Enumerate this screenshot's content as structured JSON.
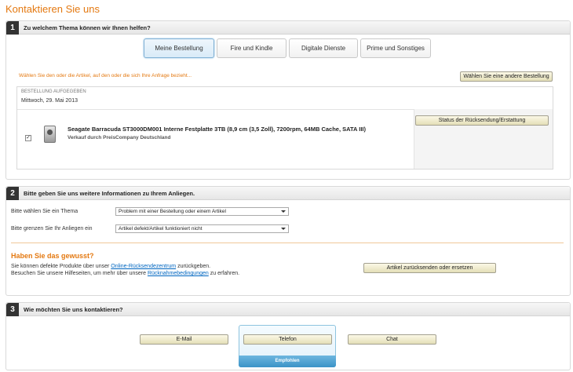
{
  "page_title": "Kontaktieren Sie uns",
  "section1": {
    "num": "1",
    "title": "Zu welchem Thema können wir Ihnen helfen?",
    "tabs": [
      {
        "label": "Meine Bestellung"
      },
      {
        "label": "Fire und Kindle"
      },
      {
        "label": "Digitale Dienste"
      },
      {
        "label": "Prime und Sonstiges"
      }
    ],
    "select_hint": "Wählen Sie den oder die Artikel, auf den oder die sich Ihre Anfrage bezieht...",
    "other_order_button": "Wählen Sie eine andere Bestellung",
    "order": {
      "label": "BESTELLUNG AUFGEGEBEN",
      "date": "Mittwoch, 29. Mai 2013",
      "checkbox": "✓",
      "product_title": "Seagate Barracuda ST3000DM001 Interne Festplatte 3TB (8,9 cm (3,5 Zoll), 7200rpm, 64MB Cache, SATA III)",
      "seller": "Verkauf durch PreisCompany Deutschland",
      "status_button": "Status der Rücksendung/Erstattung"
    }
  },
  "section2": {
    "num": "2",
    "title": "Bitte geben Sie uns weitere Informationen zu Ihrem Anliegen.",
    "topic_label": "Bitte wählen Sie ein Thema",
    "topic_value": "Problem mit einer Bestellung oder einem Artikel",
    "narrow_label": "Bitte grenzen Sie Ihr Anliegen ein",
    "narrow_value": "Artikel defekt/Artikel funktioniert nicht",
    "know_title": "Haben Sie das gewusst?",
    "know_line1_prefix": "Sie können defekte Produkte über unser ",
    "know_line1_link": "Online-Rücksendezentrum",
    "know_line1_suffix": " zurückgeben.",
    "know_line2_prefix": "Besuchen Sie unsere Hilfeseiten, um mehr über unsere ",
    "know_line2_link": "Rücknahmebedingungen",
    "know_line2_suffix": " zu erfahren.",
    "return_button": "Artikel zurücksenden oder ersetzen"
  },
  "section3": {
    "num": "3",
    "title": "Wie möchten Sie uns kontaktieren?",
    "email_button": "E-Mail",
    "phone_button": "Telefon",
    "chat_button": "Chat",
    "recommended": "Empfohlen"
  }
}
